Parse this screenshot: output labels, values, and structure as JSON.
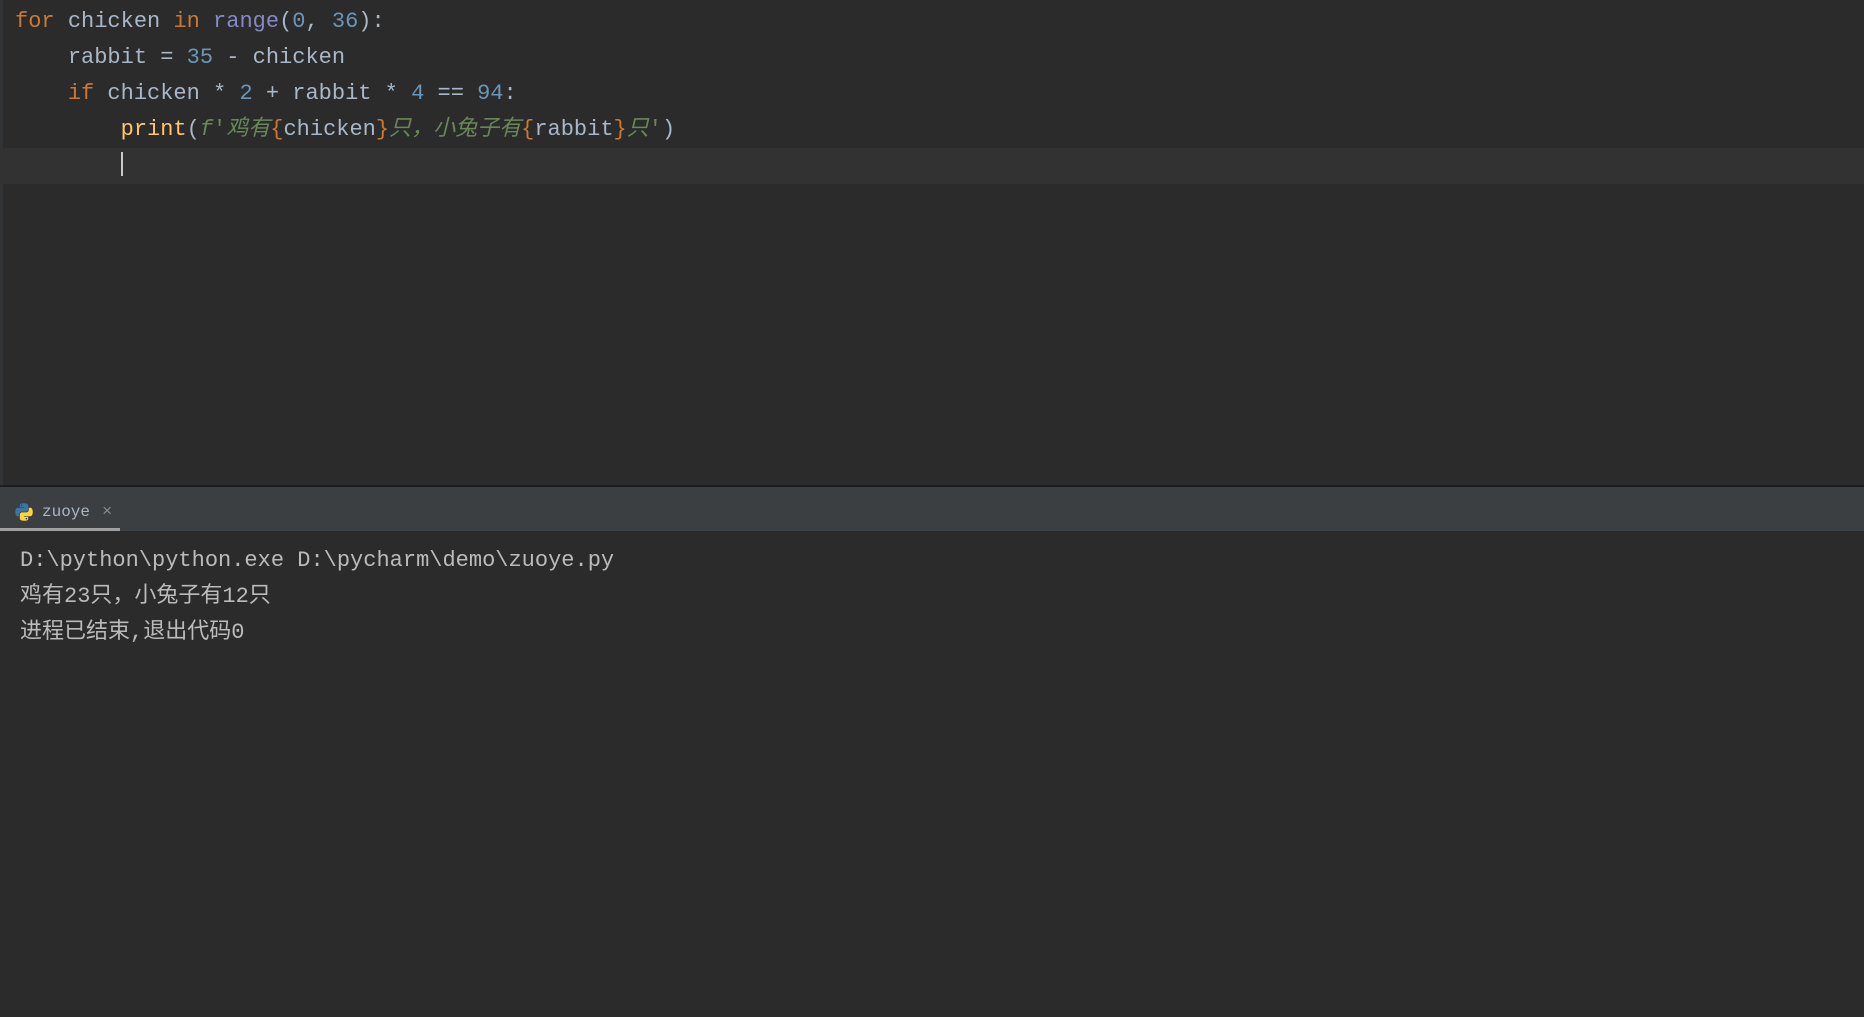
{
  "code": {
    "line1": {
      "for": "for",
      "var": "chicken",
      "in": "in",
      "range": "range",
      "paren_open": "(",
      "arg1": "0",
      "comma": ", ",
      "arg2": "36",
      "paren_close": ")",
      "colon": ":"
    },
    "line2": {
      "indent": "    ",
      "lhs": "rabbit",
      "eq": " = ",
      "n1": "35",
      "minus": " - ",
      "rhs": "chicken"
    },
    "line3": {
      "indent": "    ",
      "if": "if",
      "sp1": " ",
      "a": "chicken",
      "mul1": " * ",
      "two": "2",
      "plus": " + ",
      "b": "rabbit",
      "mul2": " * ",
      "four": "4",
      "eqeq": " == ",
      "n94": "94",
      "colon": ":"
    },
    "line4": {
      "indent": "        ",
      "print": "print",
      "paren_open": "(",
      "fprefix": "f",
      "q1": "'",
      "s1": "鸡有",
      "br1o": "{",
      "v1": "chicken",
      "br1c": "}",
      "s2": "只，小兔子有",
      "br2o": "{",
      "v2": "rabbit",
      "br2c": "}",
      "s3": "只",
      "q2": "'",
      "paren_close": ")"
    },
    "line5": {
      "indent": "        "
    }
  },
  "console": {
    "tab_name": "zuoye",
    "close_label": "×",
    "output_command": "D:\\python\\python.exe D:\\pycharm\\demo\\zuoye.py",
    "output_line1": "鸡有23只，小兔子有12只",
    "output_blank": "",
    "output_exit": "进程已结束,退出代码0"
  }
}
